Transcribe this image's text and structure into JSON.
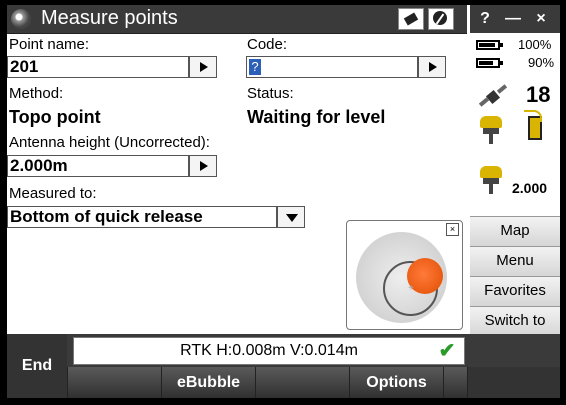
{
  "title_bar": {
    "title": "Measure points",
    "satellite_status_icon": "satellite-off-icon",
    "signal_status_icon": "no-signal-icon"
  },
  "window_controls": {
    "help": "?",
    "minimize": "—",
    "close": "×"
  },
  "form": {
    "point_name_label": "Point name:",
    "point_name_value": "201",
    "code_label": "Code:",
    "code_value": "",
    "code_cursor": "?",
    "method_label": "Method:",
    "method_value": "Topo point",
    "status_label": "Status:",
    "status_value": "Waiting for level",
    "antenna_height_label": "Antenna height (Uncorrected):",
    "antenna_height_value": "2.000m",
    "measured_to_label": "Measured to:",
    "measured_to_value": "Bottom of quick release"
  },
  "bubble": {
    "close_label": "×",
    "center_mark": "+"
  },
  "status_panel": {
    "battery1_pct": "100%",
    "battery1_level": 1.0,
    "battery2_pct": "90%",
    "battery2_level": 0.9,
    "satellites": "18",
    "antenna_height": "2.000"
  },
  "side_menu": {
    "map": "Map",
    "menu": "Menu",
    "favorites": "Favorites",
    "switch_to": "Switch to"
  },
  "bottom": {
    "end": "End",
    "status_text": "RTK H:0.008m V:0.014m",
    "status_check": "✔",
    "softkeys": [
      "",
      "eBubble",
      "",
      "Options",
      "",
      ""
    ]
  },
  "colors": {
    "titlebar": "#3a3a3a",
    "bubble_dot": "#e8601c",
    "accent_yellow": "#d9b400",
    "check_green": "#2a9a2a"
  }
}
